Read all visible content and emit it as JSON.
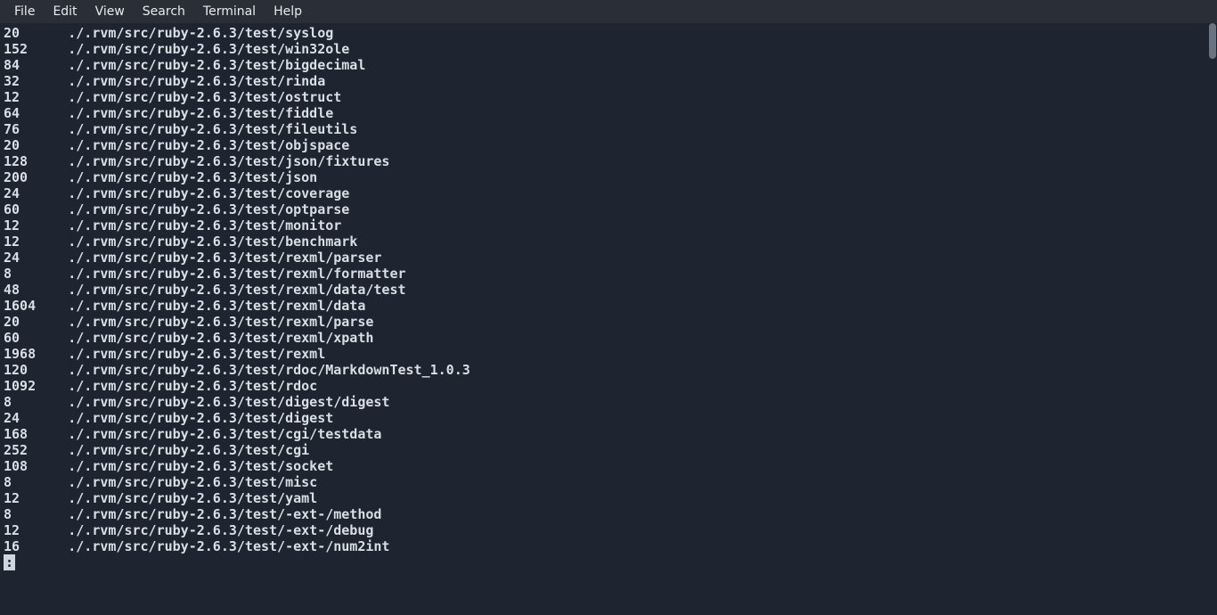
{
  "menubar": {
    "items": [
      "File",
      "Edit",
      "View",
      "Search",
      "Terminal",
      "Help"
    ]
  },
  "terminal": {
    "base_path": "./.rvm/src/ruby-2.6.3/test/",
    "entries": [
      {
        "size": "20",
        "dir": "syslog"
      },
      {
        "size": "152",
        "dir": "win32ole"
      },
      {
        "size": "84",
        "dir": "bigdecimal"
      },
      {
        "size": "32",
        "dir": "rinda"
      },
      {
        "size": "12",
        "dir": "ostruct"
      },
      {
        "size": "64",
        "dir": "fiddle"
      },
      {
        "size": "76",
        "dir": "fileutils"
      },
      {
        "size": "20",
        "dir": "objspace"
      },
      {
        "size": "128",
        "dir": "json/fixtures"
      },
      {
        "size": "200",
        "dir": "json"
      },
      {
        "size": "24",
        "dir": "coverage"
      },
      {
        "size": "60",
        "dir": "optparse"
      },
      {
        "size": "12",
        "dir": "monitor"
      },
      {
        "size": "12",
        "dir": "benchmark"
      },
      {
        "size": "24",
        "dir": "rexml/parser"
      },
      {
        "size": "8",
        "dir": "rexml/formatter"
      },
      {
        "size": "48",
        "dir": "rexml/data/test"
      },
      {
        "size": "1604",
        "dir": "rexml/data"
      },
      {
        "size": "20",
        "dir": "rexml/parse"
      },
      {
        "size": "60",
        "dir": "rexml/xpath"
      },
      {
        "size": "1968",
        "dir": "rexml"
      },
      {
        "size": "120",
        "dir": "rdoc/MarkdownTest_1.0.3"
      },
      {
        "size": "1092",
        "dir": "rdoc"
      },
      {
        "size": "8",
        "dir": "digest/digest"
      },
      {
        "size": "24",
        "dir": "digest"
      },
      {
        "size": "168",
        "dir": "cgi/testdata"
      },
      {
        "size": "252",
        "dir": "cgi"
      },
      {
        "size": "108",
        "dir": "socket"
      },
      {
        "size": "8",
        "dir": "misc"
      },
      {
        "size": "12",
        "dir": "yaml"
      },
      {
        "size": "8",
        "dir": "-ext-/method"
      },
      {
        "size": "12",
        "dir": "-ext-/debug"
      },
      {
        "size": "16",
        "dir": "-ext-/num2int"
      }
    ],
    "pager_prompt": ":"
  }
}
